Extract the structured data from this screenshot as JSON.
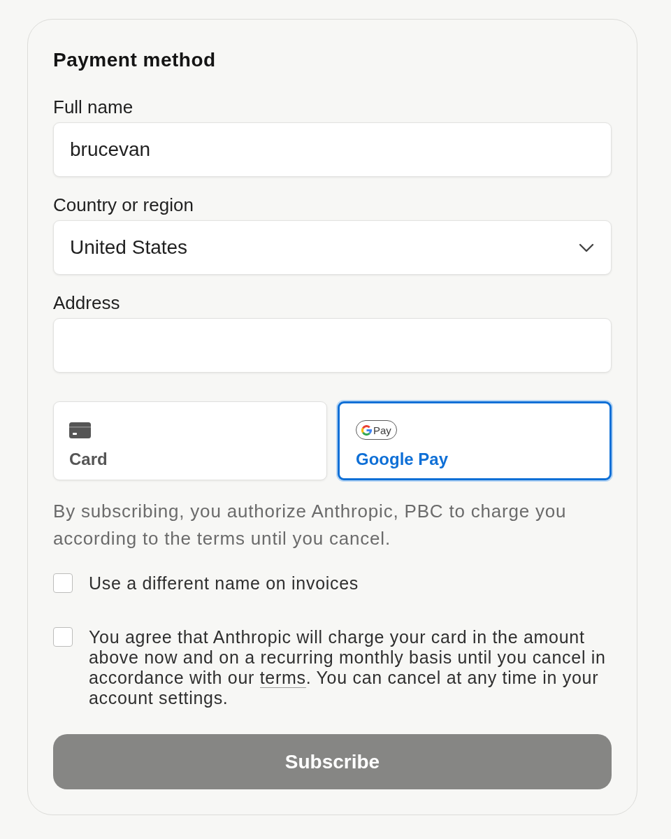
{
  "title": "Payment method",
  "fields": [
    {
      "kind": "text",
      "label": "Full name",
      "value": "brucevan"
    },
    {
      "kind": "select",
      "label": "Country or region",
      "value": "United States"
    },
    {
      "kind": "text",
      "label": "Address"
    }
  ],
  "payment_options": [
    {
      "kind": "card",
      "label": "Card",
      "selected": false
    },
    {
      "kind": "google_pay",
      "label": "Google Pay",
      "logo_text": "Pay",
      "selected": true
    }
  ],
  "notice": "By subscribing, you authorize Anthropic, PBC to charge you according to the terms until you cancel.",
  "checkboxes": [
    {
      "label": "Use a different name on invoices",
      "checked": false
    },
    {
      "label": "You agree that Anthropic will charge your card in the amount above now and on a recurring monthly basis until you cancel in accordance with our ",
      "link": "terms",
      "label_after": ". You can cancel at any time in your account settings.",
      "checked": false
    }
  ],
  "submit": {
    "label": "Subscribe",
    "disabled": true
  }
}
